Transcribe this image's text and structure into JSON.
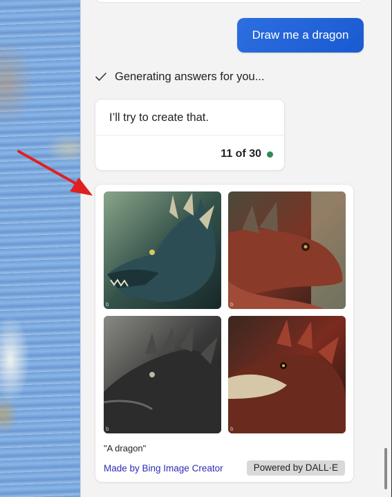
{
  "chat": {
    "user_prompt": "Draw me a dragon",
    "status_text": "Generating answers for you...",
    "answer": {
      "text": "I’ll try to create that.",
      "counter": "11 of 30",
      "counter_dot_color": "#2e8b57"
    },
    "image_result": {
      "images": [
        {
          "subject": "green-blue dragon head",
          "color": "#35524a"
        },
        {
          "subject": "red-brown dragon head",
          "color": "#7a3324"
        },
        {
          "subject": "dark grey dragon head",
          "color": "#3b3b3b"
        },
        {
          "subject": "red-cream dragon head",
          "color": "#7b2b1f"
        }
      ],
      "caption": "\"A dragon\"",
      "credit_link": "Made by Bing Image Creator",
      "powered_by": "Powered by DALL·E"
    }
  },
  "colors": {
    "user_bubble": "#1a5ad1",
    "annotation_arrow": "#e02020",
    "link": "#2b2bb8"
  },
  "icons": {
    "status": "check-icon"
  }
}
